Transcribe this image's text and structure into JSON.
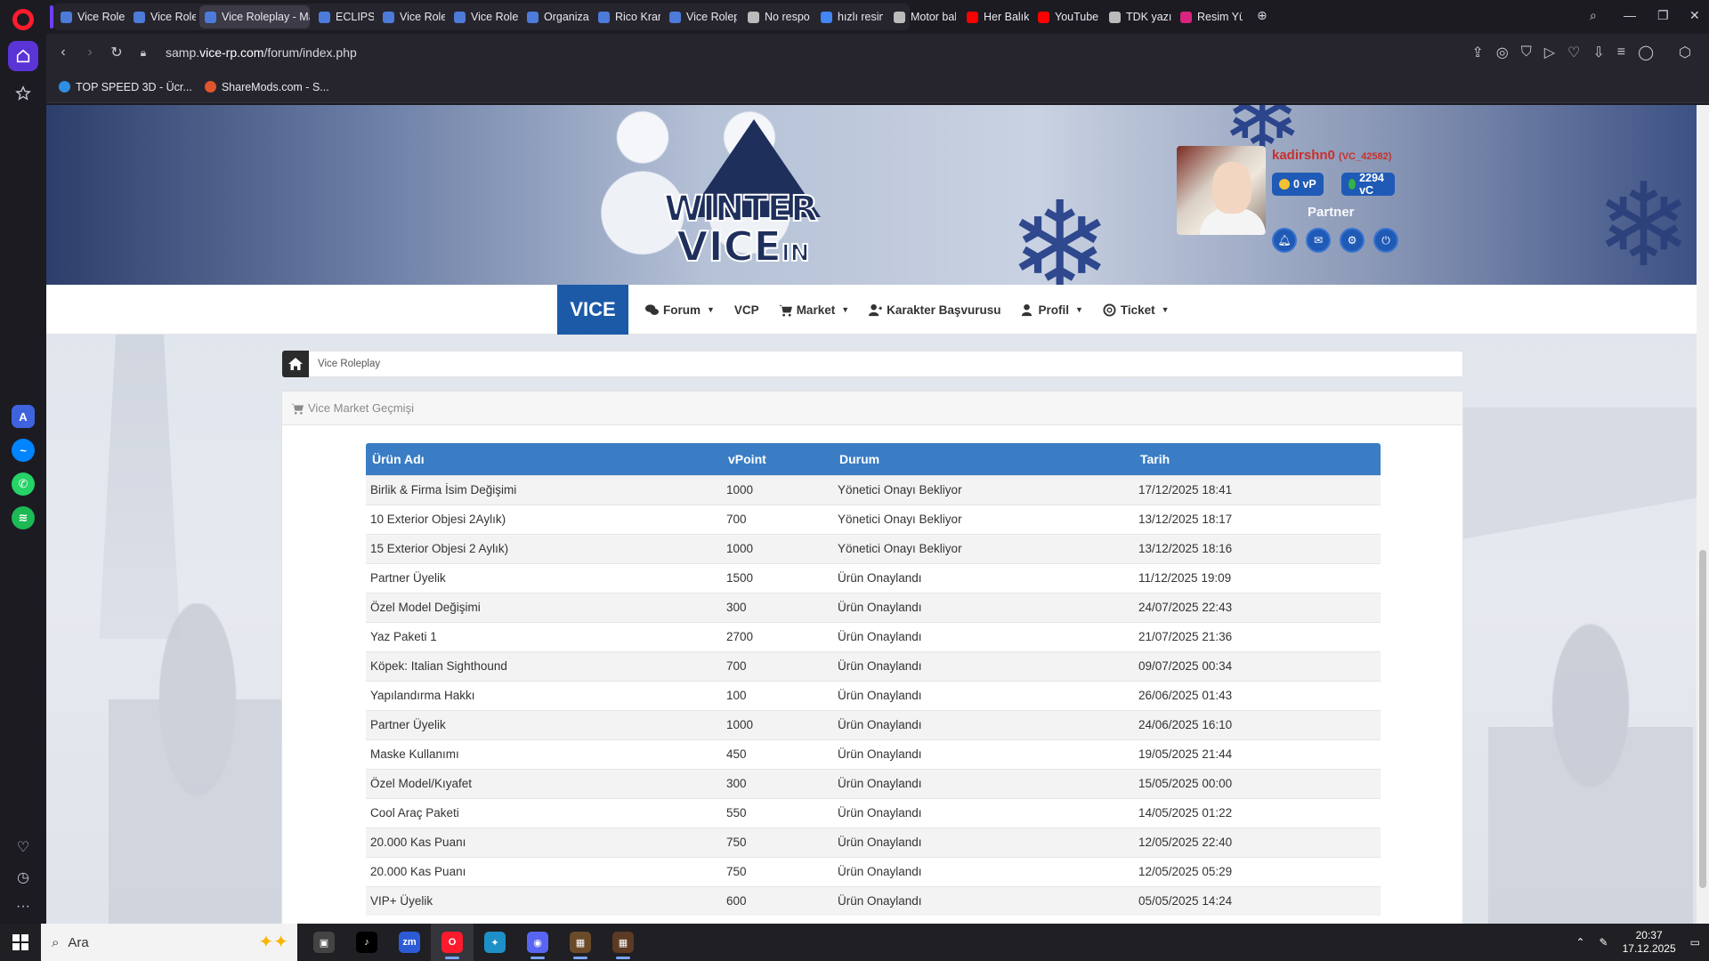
{
  "browser": {
    "tabs": [
      {
        "label": "Vice Roleplay",
        "fav_color": "#4c7bd9",
        "active": false
      },
      {
        "label": "Vice Roleplay",
        "fav_color": "#4c7bd9",
        "active": false
      },
      {
        "label": "Vice Roleplay - Market",
        "fav_color": "#4c7bd9",
        "active": true
      },
      {
        "label": "ECLIPSE - The",
        "fav_color": "#4c7bd9",
        "active": false
      },
      {
        "label": "Vice Roleplay",
        "fav_color": "#4c7bd9",
        "active": false
      },
      {
        "label": "Vice Roleplay",
        "fav_color": "#4c7bd9",
        "active": false
      },
      {
        "label": "Organizasyon",
        "fav_color": "#4c7bd9",
        "active": false
      },
      {
        "label": "Rico Kranz",
        "fav_color": "#4c7bd9",
        "active": false
      },
      {
        "label": "Vice Roleplay",
        "fav_color": "#4c7bd9",
        "active": false
      },
      {
        "label": "No response",
        "fav_color": "#bbbbbb",
        "active": false
      },
      {
        "label": "hızlı resim yü",
        "fav_color": "#4285f4",
        "active": false
      },
      {
        "label": "Motor bakım",
        "fav_color": "#bbbbbb",
        "active": false
      },
      {
        "label": "Her Balıkçının",
        "fav_color": "#ff0000",
        "active": false
      },
      {
        "label": "YouTube",
        "fav_color": "#ff0000",
        "active": false
      },
      {
        "label": "TDK yazım ha",
        "fav_color": "#bbbbbb",
        "active": false
      },
      {
        "label": "Resim Yükle",
        "fav_color": "#d6247f",
        "active": false
      }
    ],
    "url_prefix": "samp.",
    "url_domain": "vice-rp.com",
    "url_path": "/forum/index.php",
    "bookmarks": [
      {
        "label": "TOP SPEED 3D - Ücr...",
        "color": "#2f8de4"
      },
      {
        "label": "ShareMods.com - S...",
        "color": "#e0562c"
      }
    ]
  },
  "site": {
    "logo_line1": "WINTER",
    "logo_in": "IN",
    "logo_line2": "VICE",
    "profile": {
      "username": "kadirshn0",
      "user_id": "(VC_42582)",
      "vp": "0 vP",
      "vc": "2294 vC",
      "rank": "Partner"
    },
    "nav": {
      "brand": "VICE",
      "items": [
        {
          "label": "Forum",
          "icon": "comments-icon",
          "dropdown": true
        },
        {
          "label": "VCP",
          "icon": "",
          "dropdown": false
        },
        {
          "label": "Market",
          "icon": "cart-icon",
          "dropdown": true
        },
        {
          "label": "Karakter Başvurusu",
          "icon": "user-plus-icon",
          "dropdown": false
        },
        {
          "label": "Profil",
          "icon": "user-icon",
          "dropdown": true
        },
        {
          "label": "Ticket",
          "icon": "lifebuoy-icon",
          "dropdown": true
        }
      ]
    },
    "breadcrumb": "Vice Roleplay",
    "panel_title": "Vice Market Geçmişi",
    "table": {
      "headers": [
        "Ürün Adı",
        "vPoint",
        "Durum",
        "Tarih"
      ],
      "rows": [
        [
          "Birlik & Firma İsim Değişimi",
          "1000",
          "Yönetici Onayı Bekliyor",
          "17/12/2025 18:41"
        ],
        [
          "10 Exterior Objesi 2Aylık)",
          "700",
          "Yönetici Onayı Bekliyor",
          "13/12/2025 18:17"
        ],
        [
          "15 Exterior Objesi 2 Aylık)",
          "1000",
          "Yönetici Onayı Bekliyor",
          "13/12/2025 18:16"
        ],
        [
          "Partner Üyelik",
          "1500",
          "Ürün Onaylandı",
          "11/12/2025 19:09"
        ],
        [
          "Özel Model Değişimi",
          "300",
          "Ürün Onaylandı",
          "24/07/2025 22:43"
        ],
        [
          "Yaz Paketi 1",
          "2700",
          "Ürün Onaylandı",
          "21/07/2025 21:36"
        ],
        [
          "Köpek: Italian Sighthound",
          "700",
          "Ürün Onaylandı",
          "09/07/2025 00:34"
        ],
        [
          "Yapılandırma Hakkı",
          "100",
          "Ürün Onaylandı",
          "26/06/2025 01:43"
        ],
        [
          "Partner Üyelik",
          "1000",
          "Ürün Onaylandı",
          "24/06/2025 16:10"
        ],
        [
          "Maske Kullanımı",
          "450",
          "Ürün Onaylandı",
          "19/05/2025 21:44"
        ],
        [
          "Özel Model/Kıyafet",
          "300",
          "Ürün Onaylandı",
          "15/05/2025 00:00"
        ],
        [
          "Cool Araç Paketi",
          "550",
          "Ürün Onaylandı",
          "14/05/2025 01:22"
        ],
        [
          "20.000 Kas Puanı",
          "750",
          "Ürün Onaylandı",
          "12/05/2025 22:40"
        ],
        [
          "20.000 Kas Puanı",
          "750",
          "Ürün Onaylandı",
          "12/05/2025 05:29"
        ],
        [
          "VIP+ Üyelik",
          "600",
          "Ürün Onaylandı",
          "05/05/2025 14:24"
        ]
      ]
    }
  },
  "taskbar": {
    "search_placeholder": "Ara",
    "time": "20:37",
    "date": "17.12.2025",
    "apps": [
      {
        "name": "task-view-icon",
        "color": "#444",
        "glyph": "▣",
        "open": false
      },
      {
        "name": "tiktok-icon",
        "color": "#000000",
        "glyph": "♪",
        "open": false
      },
      {
        "name": "zoom-icon",
        "color": "#2d5bd6",
        "glyph": "zm",
        "open": false
      },
      {
        "name": "opera-icon",
        "color": "#ff1b2d",
        "glyph": "O",
        "open": true
      },
      {
        "name": "game-launcher-icon",
        "color": "#1e90c8",
        "glyph": "✦",
        "open": false
      },
      {
        "name": "discord-icon",
        "color": "#5865f2",
        "glyph": "◉",
        "open": true
      },
      {
        "name": "game-icon-1",
        "color": "#6b4a2a",
        "glyph": "▦",
        "open": true
      },
      {
        "name": "game-icon-2",
        "color": "#5c3a24",
        "glyph": "▦",
        "open": true
      }
    ]
  }
}
